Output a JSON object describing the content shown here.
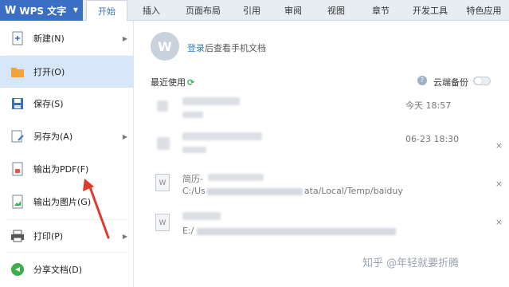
{
  "app": {
    "name": "WPS 文字",
    "logo": "W"
  },
  "tabs": [
    "开始",
    "插入",
    "页面布局",
    "引用",
    "审阅",
    "视图",
    "章节",
    "开发工具",
    "特色应用"
  ],
  "menu": [
    {
      "label": "新建(N)",
      "icon": "new-doc-icon",
      "has_submenu": true
    },
    {
      "label": "打开(O)",
      "icon": "open-folder-icon",
      "has_submenu": false,
      "selected": true
    },
    {
      "label": "保存(S)",
      "icon": "save-icon",
      "has_submenu": false
    },
    {
      "label": "另存为(A)",
      "icon": "save-as-icon",
      "has_submenu": true
    },
    {
      "label": "输出为PDF(F)",
      "icon": "pdf-export-icon",
      "has_submenu": false
    },
    {
      "label": "输出为图片(G)",
      "icon": "image-export-icon",
      "has_submenu": false
    },
    {
      "label": "打印(P)",
      "icon": "print-icon",
      "has_submenu": true
    },
    {
      "label": "分享文档(D)",
      "icon": "share-icon",
      "has_submenu": false
    }
  ],
  "login": {
    "link": "登录",
    "rest": "后查看手机文档"
  },
  "recent": {
    "title": "最近使用",
    "cloud_backup": "云端备份"
  },
  "files": [
    {
      "name": "",
      "path": "",
      "time": "今天 18:57",
      "close": ""
    },
    {
      "name": "",
      "path": "",
      "time": "06-23 18:30",
      "close": "×"
    },
    {
      "name": "简历-",
      "path": "C:/Us ata/Local/Temp/baiduy",
      "time": "",
      "close": "×"
    },
    {
      "name": "",
      "path": "E:/",
      "time": "",
      "close": "×"
    }
  ],
  "watermark": "知乎 @年轻就要折腾",
  "colors": {
    "accent": "#3b6fc4",
    "selected": "#d7e6f8",
    "arrow": "#e03a2f"
  }
}
